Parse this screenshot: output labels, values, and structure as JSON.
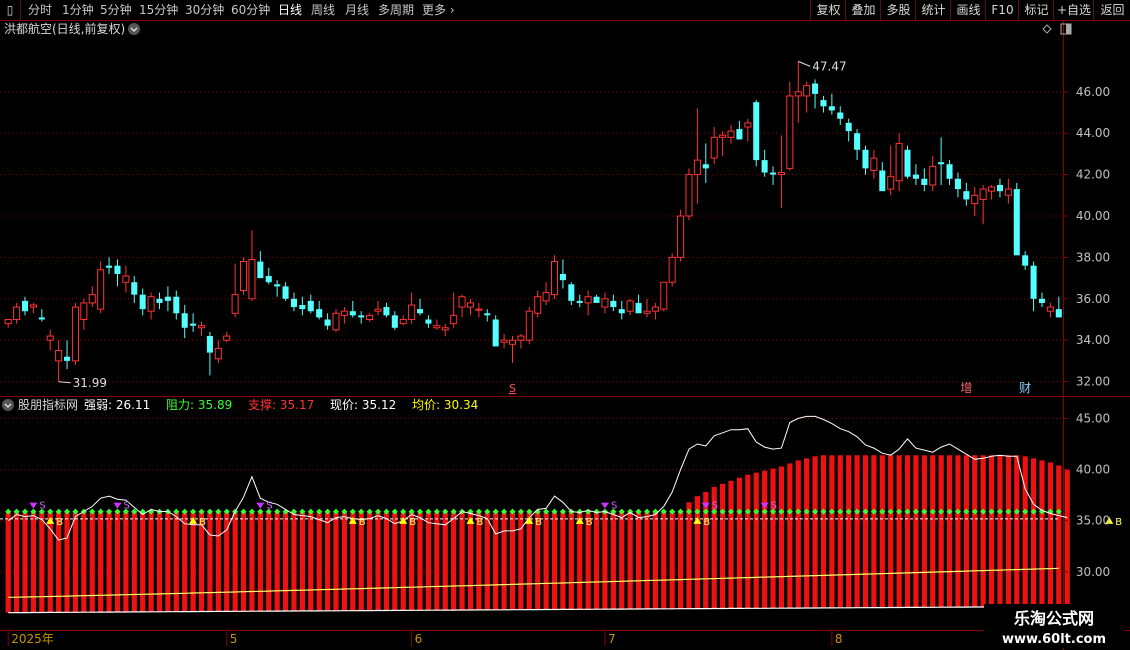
{
  "toolbar": {
    "left": [
      "分时",
      "1分钟",
      "5分钟",
      "15分钟",
      "30分钟",
      "60分钟",
      "日线",
      "周线",
      "月线",
      "多周期",
      "更多"
    ],
    "right": [
      "复权",
      "叠加",
      "多股",
      "统计",
      "画线",
      "F10",
      "+自选",
      "返回"
    ],
    "mark_label": "标记"
  },
  "header": {
    "stock": "洪都航空(日线,前复权)"
  },
  "indicator": {
    "name": "股朋指标网",
    "items": [
      {
        "label": "强弱:",
        "value": "26.11",
        "color": "#ffffff"
      },
      {
        "label": "阻力:",
        "value": "35.89",
        "color": "#33ff33"
      },
      {
        "label": "支撑:",
        "value": "35.17",
        "color": "#ff3333"
      },
      {
        "label": "现价:",
        "value": "35.12",
        "color": "#ffffff"
      },
      {
        "label": "均价:",
        "value": "30.34",
        "color": "#ffff00"
      }
    ],
    "signal_labels": {
      "buy": "B",
      "sell": "S"
    }
  },
  "watermark": {
    "line1": "乐淘公式网",
    "line2": "www.60lt.com"
  },
  "event_markers": [
    {
      "label": "增",
      "index": 114
    },
    {
      "label": "财",
      "index": 121
    }
  ],
  "s_marker": {
    "label": "S",
    "index": 60
  },
  "colors": {
    "up": "#ff3333",
    "down": "#54ffff",
    "grid": "#8b0000",
    "axis": "#c0c0c0"
  },
  "chart_data": {
    "type": "candlestick",
    "price_axis": {
      "ticks": [
        "46.00",
        "44.00",
        "42.00",
        "40.00",
        "38.00",
        "36.00",
        "34.00",
        "32.00"
      ],
      "ylim": [
        31.4,
        48.6
      ]
    },
    "indicator_axis": {
      "ticks": [
        "45.00",
        "40.00",
        "35.00",
        "30.00"
      ],
      "ylim": [
        24.5,
        47.0
      ]
    },
    "max_label": "47.47",
    "min_label": "31.99",
    "date_labels": [
      {
        "text": "2025年",
        "index": 0
      },
      {
        "text": "5",
        "index": 26
      },
      {
        "text": "6",
        "index": 48
      },
      {
        "text": "7",
        "index": 71
      },
      {
        "text": "8",
        "index": 98
      }
    ],
    "candles": [
      [
        34.8,
        35.0,
        34.6,
        35.0
      ],
      [
        35.0,
        35.8,
        34.8,
        35.6
      ],
      [
        35.9,
        36.1,
        35.2,
        35.4
      ],
      [
        35.6,
        35.8,
        35.3,
        35.7
      ],
      [
        35.1,
        35.5,
        34.9,
        35.0
      ],
      [
        34.0,
        34.5,
        33.5,
        34.2
      ],
      [
        33.0,
        34.0,
        31.99,
        33.5
      ],
      [
        33.2,
        34.0,
        32.6,
        33.0
      ],
      [
        33.0,
        35.8,
        32.8,
        35.6
      ],
      [
        35.0,
        36.0,
        34.5,
        35.8
      ],
      [
        35.8,
        36.6,
        35.6,
        36.2
      ],
      [
        35.5,
        37.8,
        35.3,
        37.4
      ],
      [
        37.6,
        38.0,
        37.2,
        37.5
      ],
      [
        37.6,
        37.9,
        36.6,
        37.2
      ],
      [
        36.8,
        37.6,
        36.3,
        37.1
      ],
      [
        36.8,
        37.1,
        35.8,
        36.2
      ],
      [
        36.2,
        36.5,
        35.2,
        35.5
      ],
      [
        35.4,
        36.3,
        35.0,
        36.1
      ],
      [
        36.0,
        36.3,
        35.5,
        35.8
      ],
      [
        36.1,
        36.6,
        35.4,
        35.9
      ],
      [
        36.1,
        36.4,
        35.0,
        35.3
      ],
      [
        35.3,
        35.7,
        34.1,
        34.6
      ],
      [
        34.8,
        35.3,
        34.4,
        34.7
      ],
      [
        34.6,
        34.9,
        34.2,
        34.7
      ],
      [
        34.2,
        34.4,
        32.3,
        33.4
      ],
      [
        33.1,
        34.0,
        32.9,
        33.6
      ],
      [
        34.0,
        34.4,
        33.9,
        34.2
      ],
      [
        35.3,
        37.7,
        35.1,
        36.2
      ],
      [
        36.4,
        38.0,
        36.2,
        37.8
      ],
      [
        36.0,
        39.3,
        35.9,
        37.9
      ],
      [
        37.8,
        38.3,
        37.0,
        37.0
      ],
      [
        37.1,
        37.5,
        36.7,
        36.8
      ],
      [
        36.7,
        36.9,
        36.1,
        36.6
      ],
      [
        36.6,
        36.8,
        35.9,
        36.0
      ],
      [
        36.0,
        36.3,
        35.4,
        35.6
      ],
      [
        35.7,
        36.1,
        35.2,
        35.5
      ],
      [
        35.9,
        36.2,
        35.3,
        35.4
      ],
      [
        35.5,
        35.9,
        35.0,
        35.1
      ],
      [
        35.0,
        35.3,
        34.5,
        34.7
      ],
      [
        34.5,
        35.5,
        34.4,
        35.3
      ],
      [
        35.2,
        35.6,
        34.8,
        35.4
      ],
      [
        35.4,
        35.9,
        35.1,
        35.2
      ],
      [
        35.2,
        35.4,
        34.8,
        35.1
      ],
      [
        35.0,
        35.3,
        34.9,
        35.2
      ],
      [
        35.4,
        35.9,
        35.2,
        35.5
      ],
      [
        35.6,
        35.8,
        35.1,
        35.2
      ],
      [
        35.2,
        35.4,
        34.5,
        34.6
      ],
      [
        34.8,
        35.2,
        34.7,
        35.0
      ],
      [
        35.0,
        36.3,
        34.8,
        35.7
      ],
      [
        35.5,
        36.0,
        35.2,
        35.3
      ],
      [
        35.0,
        35.2,
        34.6,
        34.8
      ],
      [
        34.6,
        35.0,
        34.5,
        34.7
      ],
      [
        34.5,
        34.8,
        34.2,
        34.6
      ],
      [
        34.8,
        36.3,
        34.6,
        35.2
      ],
      [
        35.6,
        36.2,
        35.1,
        36.1
      ],
      [
        35.6,
        36.0,
        35.2,
        35.8
      ],
      [
        35.5,
        35.8,
        35.1,
        35.5
      ],
      [
        35.3,
        35.5,
        34.9,
        35.2
      ],
      [
        35.0,
        35.2,
        33.8,
        33.7
      ],
      [
        33.9,
        34.3,
        33.6,
        34.0
      ],
      [
        33.8,
        34.2,
        32.9,
        34.0
      ],
      [
        34.0,
        34.3,
        33.6,
        34.2
      ],
      [
        34.0,
        35.6,
        33.8,
        35.4
      ],
      [
        35.3,
        36.4,
        35.1,
        36.1
      ],
      [
        35.9,
        36.8,
        35.7,
        36.3
      ],
      [
        36.2,
        38.1,
        36.0,
        37.8
      ],
      [
        37.2,
        37.9,
        36.5,
        36.9
      ],
      [
        36.7,
        36.8,
        35.7,
        35.9
      ],
      [
        35.9,
        36.2,
        35.6,
        35.8
      ],
      [
        35.8,
        36.4,
        35.2,
        36.1
      ],
      [
        36.1,
        36.2,
        35.9,
        35.8
      ],
      [
        35.6,
        36.3,
        35.3,
        36.0
      ],
      [
        35.9,
        36.2,
        35.4,
        35.6
      ],
      [
        35.5,
        35.9,
        35.0,
        35.3
      ],
      [
        35.4,
        36.0,
        35.2,
        35.9
      ],
      [
        35.8,
        36.2,
        35.5,
        35.3
      ],
      [
        35.3,
        36.0,
        35.1,
        35.4
      ],
      [
        35.4,
        35.8,
        35.0,
        35.6
      ],
      [
        35.5,
        36.6,
        35.4,
        36.8
      ],
      [
        36.8,
        38.2,
        36.6,
        38.0
      ],
      [
        38.0,
        40.3,
        37.8,
        40.0
      ],
      [
        40.0,
        42.3,
        39.8,
        42.0
      ],
      [
        42.0,
        45.2,
        40.6,
        42.7
      ],
      [
        42.5,
        43.5,
        41.6,
        42.3
      ],
      [
        42.8,
        44.3,
        42.5,
        43.8
      ],
      [
        43.8,
        44.1,
        42.9,
        43.9
      ],
      [
        43.8,
        44.4,
        43.5,
        44.1
      ],
      [
        44.2,
        44.6,
        43.7,
        43.7
      ],
      [
        44.3,
        44.7,
        43.6,
        44.5
      ],
      [
        45.5,
        45.6,
        42.4,
        42.7
      ],
      [
        42.7,
        43.2,
        41.9,
        42.1
      ],
      [
        42.1,
        42.4,
        41.5,
        42.0
      ],
      [
        42.0,
        43.9,
        40.4,
        42.1
      ],
      [
        42.3,
        46.5,
        42.2,
        45.8
      ],
      [
        45.8,
        47.47,
        44.5,
        46.0
      ],
      [
        45.8,
        46.5,
        45.0,
        46.3
      ],
      [
        46.4,
        46.6,
        45.2,
        45.9
      ],
      [
        45.6,
        45.8,
        45.0,
        45.3
      ],
      [
        45.3,
        45.9,
        44.9,
        45.1
      ],
      [
        45.0,
        45.3,
        44.4,
        44.7
      ],
      [
        44.5,
        44.7,
        43.6,
        44.1
      ],
      [
        44.0,
        44.2,
        42.7,
        43.2
      ],
      [
        43.2,
        43.4,
        42.0,
        42.3
      ],
      [
        42.2,
        43.2,
        41.8,
        42.8
      ],
      [
        42.2,
        42.6,
        41.6,
        41.2
      ],
      [
        41.3,
        43.4,
        41.0,
        41.9
      ],
      [
        41.7,
        44.0,
        41.2,
        43.5
      ],
      [
        43.2,
        43.4,
        41.8,
        41.9
      ],
      [
        42.0,
        42.5,
        41.5,
        41.8
      ],
      [
        41.8,
        42.3,
        41.2,
        41.5
      ],
      [
        41.5,
        42.9,
        41.2,
        42.4
      ],
      [
        42.6,
        43.8,
        41.5,
        42.5
      ],
      [
        42.5,
        42.7,
        41.5,
        41.8
      ],
      [
        41.8,
        42.1,
        40.9,
        41.3
      ],
      [
        41.2,
        41.6,
        40.5,
        40.8
      ],
      [
        40.6,
        41.4,
        40.0,
        41.0
      ],
      [
        40.8,
        41.5,
        39.6,
        41.3
      ],
      [
        41.2,
        41.5,
        40.8,
        41.4
      ],
      [
        41.5,
        41.8,
        40.9,
        41.2
      ],
      [
        41.0,
        41.8,
        40.6,
        41.3
      ],
      [
        41.3,
        41.6,
        40.1,
        38.1
      ],
      [
        38.1,
        38.3,
        37.4,
        37.6
      ],
      [
        37.6,
        37.8,
        35.4,
        36.0
      ],
      [
        36.0,
        36.3,
        35.6,
        35.8
      ],
      [
        35.4,
        35.8,
        35.1,
        35.6
      ],
      [
        35.5,
        36.1,
        35.1,
        35.1
      ]
    ],
    "resistance": 35.89,
    "support": 35.17,
    "avg_price_start": 27.5,
    "avg_price_end": 30.34,
    "bar_bottom_start": 26.0,
    "bar_bottom_end": 26.6,
    "strength_line": [
      35.0,
      35.6,
      35.4,
      35.5,
      35.1,
      34.2,
      33.1,
      33.3,
      35.4,
      35.9,
      36.4,
      37.2,
      37.4,
      37.1,
      37.0,
      36.3,
      35.6,
      36.1,
      35.9,
      35.9,
      35.4,
      34.7,
      34.6,
      34.6,
      33.6,
      33.5,
      34.1,
      35.9,
      37.3,
      39.3,
      37.2,
      36.8,
      36.6,
      36.1,
      35.6,
      35.5,
      35.4,
      35.1,
      34.8,
      35.3,
      35.4,
      35.2,
      35.1,
      35.2,
      35.5,
      35.2,
      34.7,
      35.0,
      35.6,
      35.3,
      34.8,
      34.7,
      34.6,
      35.2,
      35.9,
      35.7,
      35.5,
      35.2,
      33.7,
      34.0,
      34.0,
      34.2,
      35.3,
      36.1,
      36.2,
      37.4,
      36.8,
      35.9,
      35.8,
      36.0,
      35.8,
      35.9,
      35.6,
      35.3,
      35.8,
      35.3,
      35.4,
      35.6,
      36.4,
      37.8,
      40.0,
      42.0,
      42.5,
      42.3,
      43.3,
      43.6,
      43.9,
      43.9,
      44.0,
      42.7,
      42.2,
      42.0,
      42.1,
      44.6,
      45.0,
      45.2,
      45.2,
      44.9,
      44.5,
      44.0,
      43.7,
      43.2,
      42.4,
      42.1,
      41.6,
      41.4,
      42.0,
      43.0,
      42.1,
      41.9,
      41.7,
      42.2,
      42.5,
      42.0,
      41.5,
      41.0,
      41.1,
      41.3,
      41.4,
      41.3,
      41.3,
      38.1,
      36.6,
      36.0,
      35.7,
      35.5,
      35.3
    ],
    "bar_tops": [
      35.8,
      35.8,
      35.8,
      35.8,
      35.8,
      35.8,
      35.8,
      35.8,
      35.8,
      35.8,
      35.8,
      35.8,
      35.8,
      35.8,
      35.8,
      35.8,
      35.8,
      35.8,
      35.8,
      35.8,
      35.8,
      35.8,
      35.8,
      35.8,
      35.8,
      35.8,
      35.8,
      35.8,
      35.8,
      35.8,
      35.8,
      35.8,
      35.8,
      35.8,
      35.8,
      35.8,
      35.8,
      35.8,
      35.8,
      35.8,
      35.8,
      35.8,
      35.8,
      35.8,
      35.8,
      35.8,
      35.8,
      35.8,
      35.8,
      35.8,
      35.8,
      35.8,
      35.8,
      35.8,
      35.8,
      35.8,
      35.8,
      35.8,
      35.8,
      35.8,
      35.8,
      35.8,
      35.8,
      35.8,
      35.8,
      35.8,
      35.8,
      35.8,
      35.8,
      35.8,
      35.8,
      35.8,
      35.8,
      35.8,
      35.8,
      35.8,
      35.8,
      35.8,
      35.8,
      35.8,
      36.0,
      36.8,
      37.4,
      37.8,
      38.3,
      38.6,
      38.9,
      39.2,
      39.5,
      39.7,
      39.9,
      40.1,
      40.3,
      40.6,
      40.9,
      41.1,
      41.3,
      41.4,
      41.4,
      41.4,
      41.4,
      41.4,
      41.4,
      41.4,
      41.4,
      41.4,
      41.4,
      41.4,
      41.4,
      41.4,
      41.4,
      41.4,
      41.4,
      41.4,
      41.4,
      41.4,
      41.4,
      41.4,
      41.4,
      41.4,
      41.4,
      41.3,
      41.1,
      40.9,
      40.7,
      40.4,
      40.0
    ],
    "sell_signals": [
      3,
      13,
      30,
      71,
      83,
      90
    ],
    "buy_signals": [
      5,
      22,
      41,
      47,
      55,
      62,
      68,
      82,
      131
    ]
  }
}
